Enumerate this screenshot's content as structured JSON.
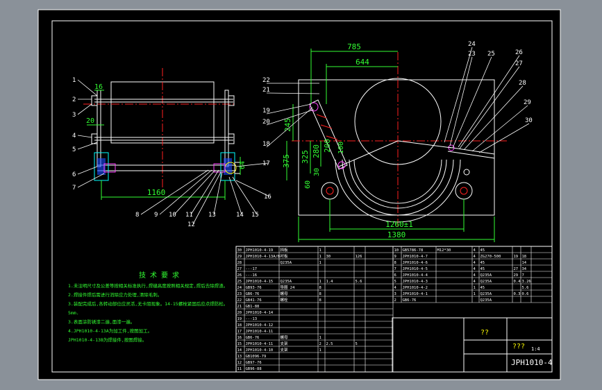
{
  "colors": {
    "bg": "#8a9199",
    "paper": "#000000",
    "line": "#ffffff",
    "center": "#ff2020",
    "dim": "#33ff33",
    "hatch": "#00ffff",
    "blue": "#3a6bff",
    "magenta": "#ff40ff",
    "yellow": "#ffff00"
  },
  "left_view": {
    "balloons": [
      "1",
      "2",
      "3",
      "4",
      "5",
      "6",
      "7",
      "8",
      "9",
      "10",
      "11",
      "12",
      "13",
      "14",
      "15",
      "16",
      "17"
    ],
    "dims": {
      "top_small": "16",
      "mid_small": "20",
      "bottom": "1160",
      "right": "64"
    }
  },
  "right_view": {
    "balloons": [
      "18",
      "19",
      "20",
      "21",
      "22",
      "23",
      "24",
      "25",
      "26",
      "27",
      "28",
      "29",
      "30"
    ],
    "dims": {
      "d785": "785",
      "d644": "644",
      "d245": "245",
      "d375": "375",
      "d325": "325",
      "d280": "280",
      "d200": "200",
      "d60": "60",
      "d100": "100",
      "d30": "30",
      "d1260": "1260±1",
      "d1380": "1380"
    }
  },
  "notes": {
    "title": "技 术 要 求",
    "lines": [
      "1.未注明尺寸及公差等按相关标准执行,焊缝高度按照相关规定,焊后去除焊渣。",
      "2.焊接件焊后需进行消除应力处理,清除毛刺。",
      "3.装配完成后,各转动部位应灵活,无卡阻现象。14-15螺栓紧固后应点焊防松。",
      "5mm.",
      "3.表面涂防锈漆二遍,面漆一遍。",
      "4.JPH1010-4-13A为加工件,按图加工。",
      "  JPH1010-4-13B为焊接件,按图焊接。"
    ]
  },
  "bom_left": [
    [
      "30",
      "JPH1010-4-19",
      "挡板",
      "1",
      "",
      ""
    ],
    [
      "29",
      "JPH1010-4-13A/B",
      "衬板",
      "1",
      "30",
      "126"
    ],
    [
      "28",
      "",
      "Q235A",
      "1",
      "",
      ""
    ],
    [
      "27",
      "---17",
      "",
      "",
      "",
      ""
    ],
    [
      "26",
      "---16",
      "",
      "",
      "",
      ""
    ],
    [
      "25",
      "JPH1010-4-15",
      "Q235A",
      "1",
      "1.4",
      "5.6"
    ],
    [
      "24",
      "GB93-76",
      "垫圈 24",
      "8",
      "",
      ""
    ],
    [
      "23",
      "GB6-76",
      "螺母",
      "8",
      "",
      ""
    ],
    [
      "22",
      "GB41-76",
      "螺栓",
      "8",
      "",
      ""
    ],
    [
      "21",
      "GB1-88",
      "",
      "",
      "",
      ""
    ],
    [
      "20",
      "JPH1010-4-14",
      "",
      "",
      "",
      ""
    ],
    [
      "19",
      "---13",
      "",
      "",
      "",
      ""
    ],
    [
      "18",
      "JPH1010-4-12",
      "",
      "",
      "",
      ""
    ],
    [
      "17",
      "JPH1010-4-11",
      "",
      "",
      "",
      ""
    ],
    [
      "16",
      "GB6-76",
      "螺母",
      "1",
      "",
      ""
    ],
    [
      "15",
      "JPH1010-4-11",
      "支架",
      "2",
      "2.5",
      "5"
    ],
    [
      "14",
      "JPH1010-4-10",
      "支架",
      "1",
      "",
      ""
    ],
    [
      "13",
      "GB1096-79",
      "",
      "",
      "",
      ""
    ],
    [
      "12",
      "GB97-76",
      "",
      "",
      "",
      ""
    ],
    [
      "11",
      "GB96-88",
      "",
      "",
      "",
      ""
    ]
  ],
  "bom_mid": [
    [
      "10",
      "GB5786-78",
      "M12*30",
      "4",
      "45",
      ""
    ],
    [
      "9",
      "JPH1010-4-7",
      "",
      "4",
      "ZG270-500",
      "19",
      "18"
    ],
    [
      "8",
      "JPH1010-4-6",
      "",
      "4",
      "45",
      "",
      "14"
    ],
    [
      "7",
      "JPH1010-4-5",
      "",
      "4",
      "45",
      "27",
      "34"
    ],
    [
      "6",
      "JPH1010-4-4",
      "",
      "4",
      "Q235A",
      "29",
      "7"
    ],
    [
      "5",
      "JPH1010-4-3",
      "",
      "4",
      "Q235A",
      "0.4",
      "3.26"
    ],
    [
      "4",
      "JPH1010-4-2",
      "",
      "1",
      "45",
      "",
      "5.6"
    ],
    [
      "3",
      "JPH1010-4-1",
      "",
      "1",
      "Q235A",
      "0.3",
      "0.6"
    ],
    [
      "2",
      "GB6-76",
      "",
      "",
      "Q235A",
      "",
      ""
    ]
  ],
  "title_block": {
    "drawing_no": "JPH1010-4",
    "name1": "??",
    "name2": "???",
    "scale": "1:4"
  }
}
